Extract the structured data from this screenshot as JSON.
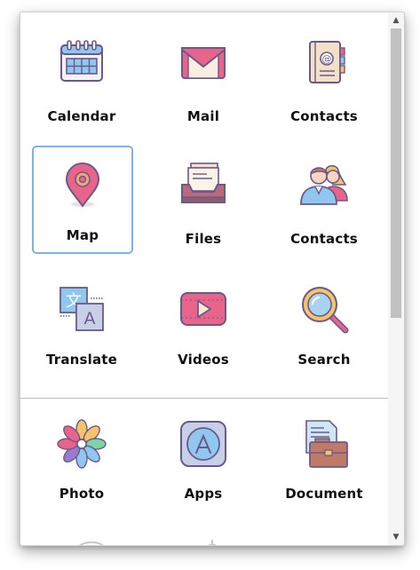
{
  "apps": {
    "row1": [
      {
        "label": "Calendar",
        "icon": "calendar-icon"
      },
      {
        "label": "Mail",
        "icon": "mail-icon"
      },
      {
        "label": "Contacts",
        "icon": "address-book-icon"
      }
    ],
    "row2": [
      {
        "label": "Map",
        "icon": "map-pin-icon",
        "selected": true
      },
      {
        "label": "Files",
        "icon": "file-tray-icon"
      },
      {
        "label": "Contacts",
        "icon": "people-icon"
      }
    ],
    "row3": [
      {
        "label": "Translate",
        "icon": "translate-icon"
      },
      {
        "label": "Videos",
        "icon": "video-play-icon"
      },
      {
        "label": "Search",
        "icon": "magnifier-icon"
      }
    ],
    "row4": [
      {
        "label": "Photo",
        "icon": "photo-flower-icon"
      },
      {
        "label": "Apps",
        "icon": "app-store-icon"
      },
      {
        "label": "Document",
        "icon": "document-briefcase-icon"
      }
    ]
  },
  "scrollbar": {
    "up_arrow": "▲",
    "down_arrow": "▼"
  },
  "colors": {
    "selection_border": "#7cb3ea",
    "label": "#111111"
  }
}
